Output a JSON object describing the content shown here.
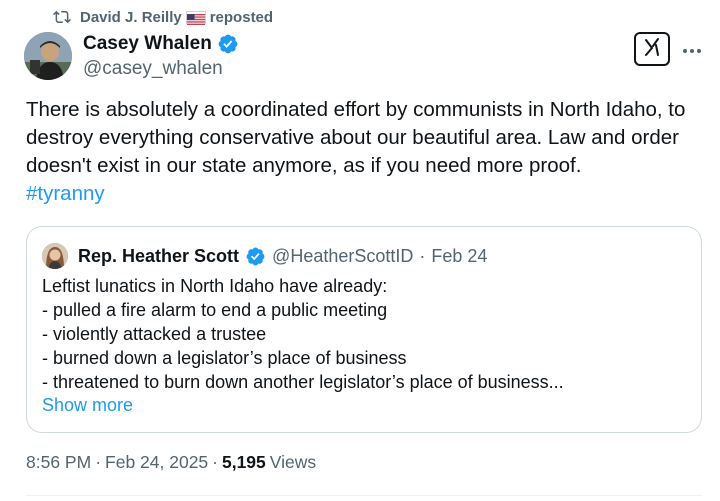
{
  "repost": {
    "user": "David J. Reilly",
    "flag": "US flag",
    "label": "reposted"
  },
  "author": {
    "display_name": "Casey Whalen",
    "handle": "@casey_whalen",
    "verified": true
  },
  "tweet": {
    "text": "There is absolutely a coordinated effort by communists in North Idaho, to destroy everything conservative about our beautiful area. Law and order doesn't exist in our state anymore, as if you need more proof.",
    "hashtag": "#tyranny"
  },
  "quote": {
    "display_name": "Rep. Heather Scott",
    "handle": "@HeatherScottID",
    "separator": "·",
    "date": "Feb 24",
    "lines": [
      "Leftist lunatics in North Idaho have already:",
      "- pulled a fire alarm to end a public meeting",
      "- violently attacked a trustee",
      "- burned down a legislator’s place of business",
      "- threatened to burn down another legislator’s place of business..."
    ],
    "show_more": "Show more"
  },
  "meta": {
    "time": "8:56 PM",
    "separator": "·",
    "date": "Feb 24, 2025",
    "separator2": "·",
    "views_count": "5,195",
    "views_label": "Views"
  },
  "colors": {
    "accent": "#1d9bf0",
    "secondary_text": "#536471",
    "primary_text": "#0f1419",
    "border": "#cfd9de"
  },
  "icons": {
    "repost": "repost-icon",
    "verified": "verified-badge-icon",
    "grok": "grok-icon",
    "more": "more-icon"
  }
}
